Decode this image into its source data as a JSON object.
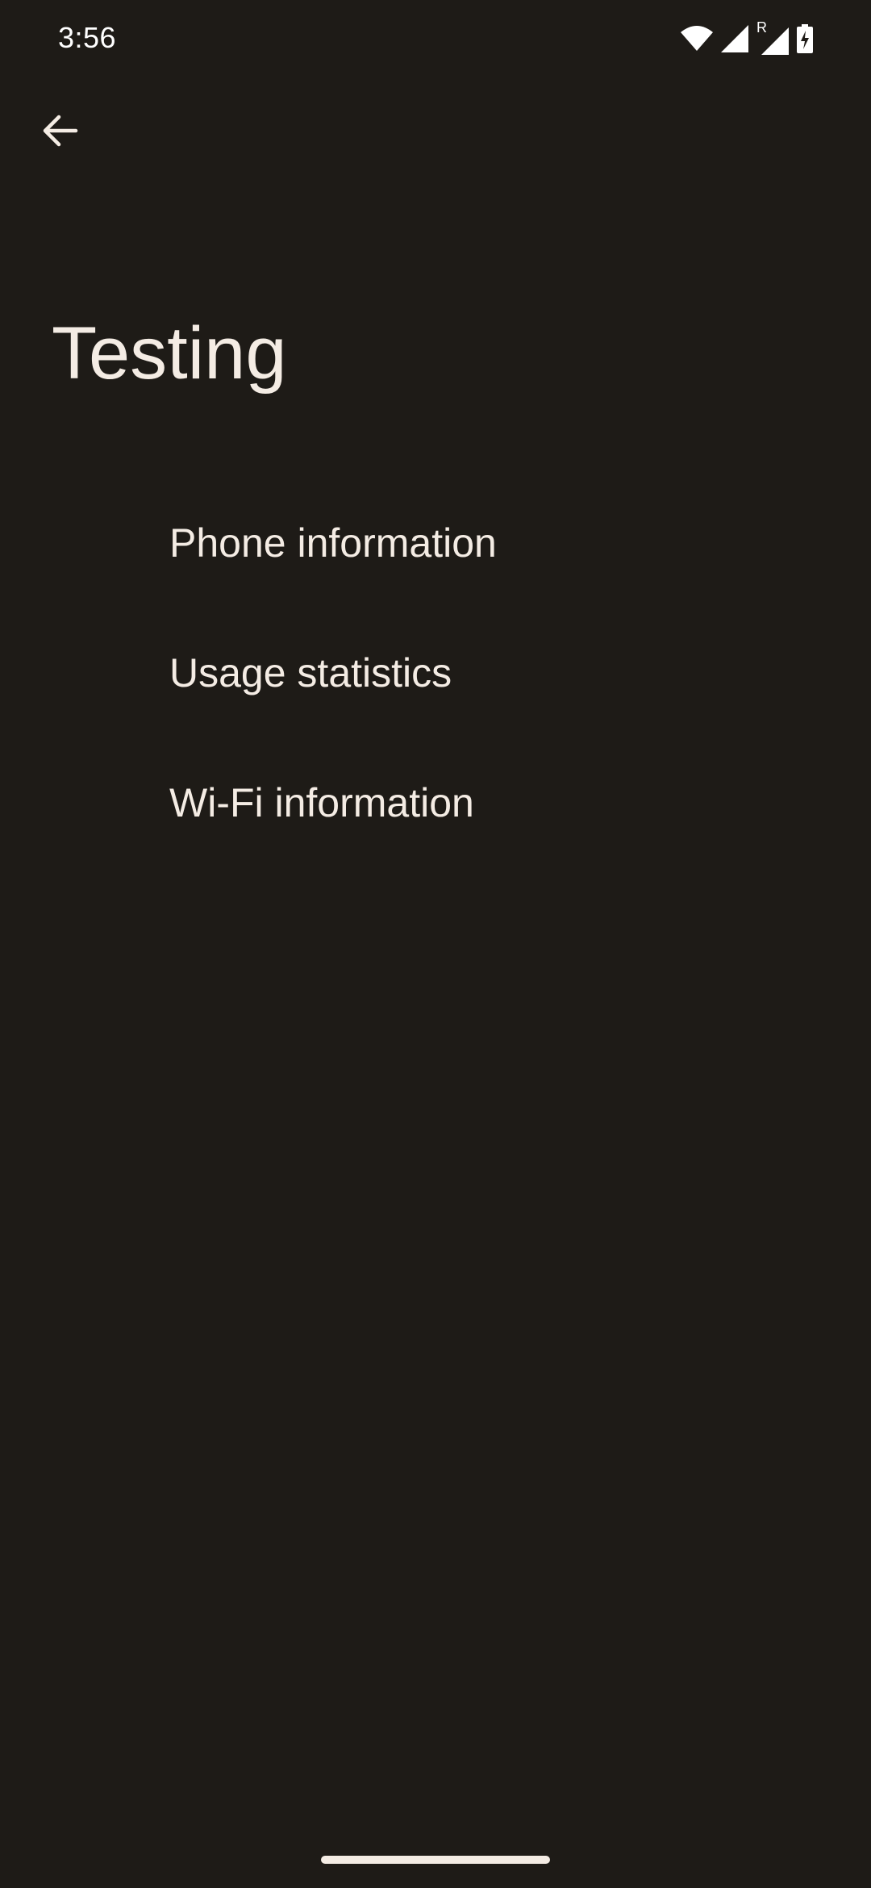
{
  "status_bar": {
    "time": "3:56",
    "roaming_label": "R",
    "icons": [
      "wifi-icon",
      "signal-icon",
      "roaming-signal-icon",
      "battery-charging-icon"
    ]
  },
  "toolbar": {
    "back_icon": "arrow-back-icon"
  },
  "page": {
    "title": "Testing"
  },
  "menu": {
    "items": [
      {
        "label": "Phone information"
      },
      {
        "label": "Usage statistics"
      },
      {
        "label": "Wi-Fi information"
      }
    ]
  },
  "colors": {
    "background": "#1e1b17",
    "text": "#f4ece4"
  }
}
